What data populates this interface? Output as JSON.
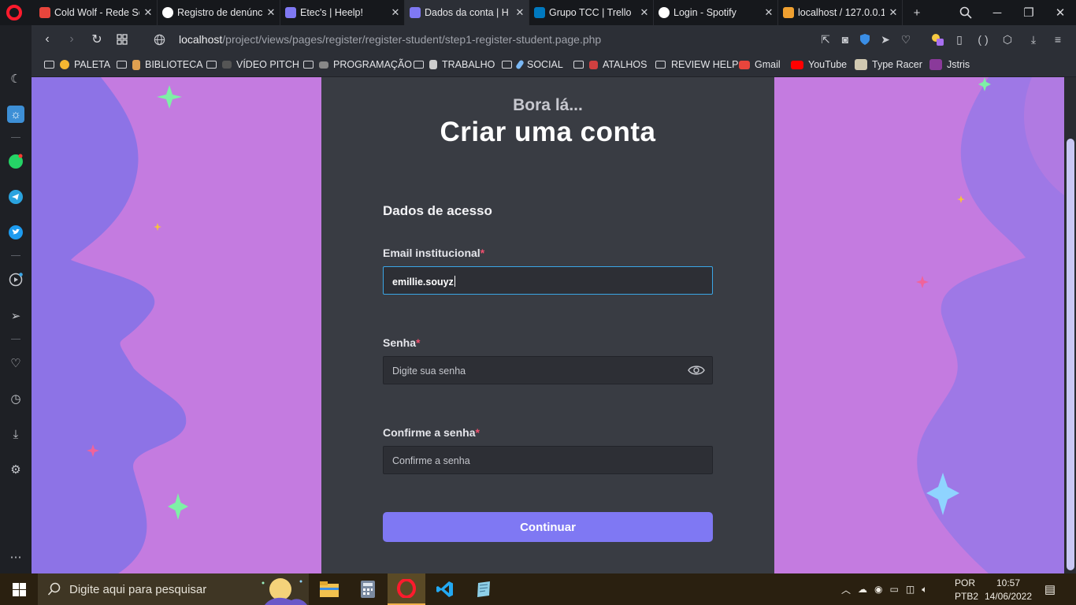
{
  "browser": {
    "tabs": [
      {
        "title": "Cold Wolf - Rede So",
        "fav": "#e8453c"
      },
      {
        "title": "Registro de denúnc",
        "fav": "#ffffff"
      },
      {
        "title": "Etec's | Heelp!",
        "fav": "#7f78f3"
      },
      {
        "title": "Dados da conta | H",
        "fav": "#7f78f3"
      },
      {
        "title": "Grupo TCC | Trello",
        "fav": "#0079bf"
      },
      {
        "title": "Login - Spotify",
        "fav": "#ffffff"
      },
      {
        "title": "localhost / 127.0.0.1",
        "fav": "#f0a030"
      }
    ],
    "url_host": "localhost",
    "url_path": "/project/views/pages/register/register-student/step1-register-student.page.php",
    "bookmarks": [
      "PALETA",
      "BIBLIOTECA",
      "VÍDEO PITCH",
      "PROGRAMAÇÃO",
      "TRABALHO",
      "SOCIAL",
      "ATALHOS",
      "REVIEW HELP",
      "Gmail",
      "YouTube",
      "Type Racer",
      "Jstris"
    ]
  },
  "page": {
    "lead": "Bora lá...",
    "title": "Criar uma conta",
    "section": "Dados de acesso",
    "email_label": "Email institucional",
    "email_value": "emillie.souyz",
    "password_label": "Senha",
    "password_placeholder": "Digite sua senha",
    "confirm_label": "Confirme a senha",
    "confirm_placeholder": "Confirme a senha",
    "required_mark": "*",
    "continue_label": "Continuar"
  },
  "taskbar": {
    "search_placeholder": "Digite aqui para pesquisar",
    "lang": "POR",
    "layout": "PTB2",
    "time": "10:57",
    "date": "14/06/2022"
  },
  "colors": {
    "accent": "#7f78f3",
    "background_pink": "#c47be0",
    "wave_purple": "#9176e6",
    "card": "#393c43"
  }
}
